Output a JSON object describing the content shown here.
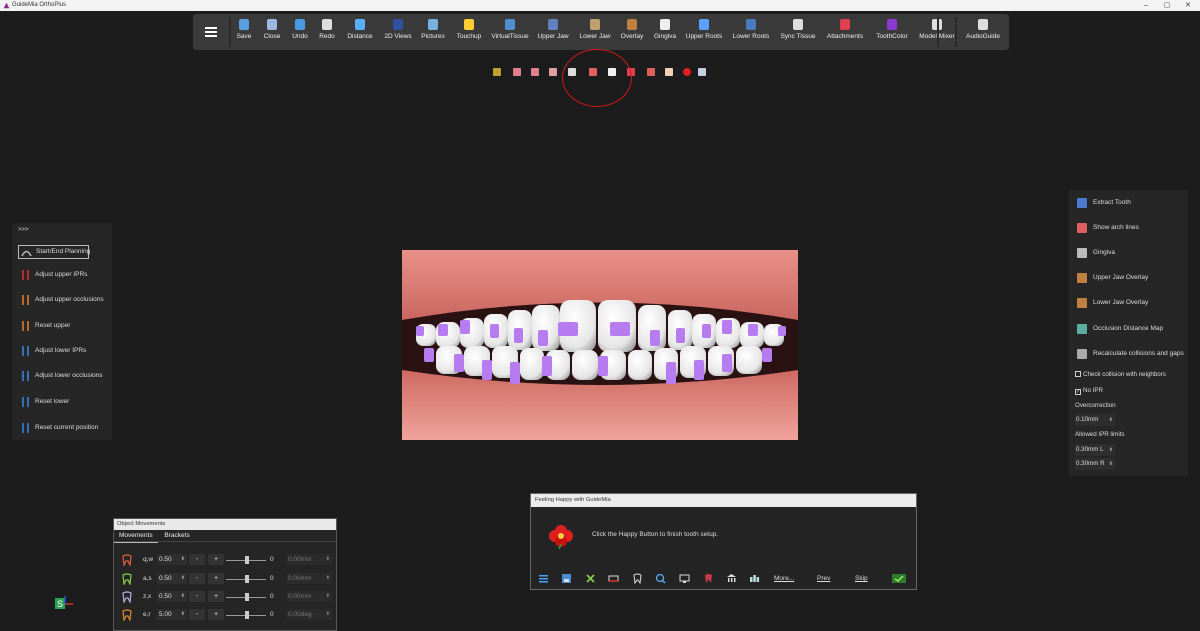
{
  "window": {
    "title": "GuideMia OrthoPlus",
    "controls": [
      "–",
      "▢",
      "✕"
    ]
  },
  "toolbar": {
    "items": [
      {
        "label": "Save",
        "icon": "save-icon"
      },
      {
        "label": "Close",
        "icon": "close-file-icon"
      },
      {
        "label": "Undo",
        "icon": "undo-icon"
      },
      {
        "label": "Redo",
        "icon": "redo-icon"
      },
      {
        "label": "Distance",
        "icon": "ruler-icon"
      },
      {
        "label": "2D Views",
        "icon": "2d-views-icon"
      },
      {
        "label": "Pictures",
        "icon": "pictures-icon"
      },
      {
        "label": "Touchup",
        "icon": "touchup-icon"
      },
      {
        "label": "VirtualTissue",
        "icon": "virtual-tissue-icon"
      },
      {
        "label": "Upper Jaw",
        "icon": "upper-jaw-icon"
      },
      {
        "label": "Lower Jaw",
        "icon": "lower-jaw-icon"
      },
      {
        "label": "Overlay",
        "icon": "overlay-icon"
      },
      {
        "label": "Gingiva",
        "icon": "gingiva-icon"
      },
      {
        "label": "Upper Roots",
        "icon": "upper-roots-icon"
      },
      {
        "label": "Lower Roots",
        "icon": "lower-roots-icon"
      },
      {
        "label": "Sync Tissue",
        "icon": "sync-tissue-icon"
      },
      {
        "label": "Attachments",
        "icon": "attachments-icon"
      },
      {
        "label": "ToothColor",
        "icon": "tooth-color-icon"
      },
      {
        "label": "Model Mixer",
        "icon": "model-mixer-icon"
      },
      {
        "label": "AudioGuide",
        "icon": "audio-guide-icon"
      }
    ]
  },
  "view_toolbar": {
    "icons": [
      "front-view-icon",
      "left-view-icon",
      "right-view-icon",
      "split-view-icon",
      "occlusal-split-icon",
      "highlighted-view-icon",
      "lower-view-icon",
      "arch-down-icon",
      "arch-up-icon",
      "hand-icon",
      "red-dot-icon",
      "fit-view-icon"
    ]
  },
  "left_panel": {
    "toggle": ">>>",
    "items": [
      {
        "label": "Start/End Planning",
        "icon": "planning-icon"
      },
      {
        "label": "Adjust upper IPRs",
        "icon": "ipr-upper-icon"
      },
      {
        "label": "Adjust upper occlusions",
        "icon": "occlusion-upper-icon"
      },
      {
        "label": "Reset upper",
        "icon": "reset-upper-icon"
      },
      {
        "label": "Adjust lower IPRs",
        "icon": "ipr-lower-icon"
      },
      {
        "label": "Adjust lower occlusions",
        "icon": "occlusion-lower-icon"
      },
      {
        "label": "Reset lower",
        "icon": "reset-lower-icon"
      },
      {
        "label": "Reset current position",
        "icon": "reset-position-icon"
      }
    ]
  },
  "right_panel": {
    "items": [
      {
        "label": "Extract Tooth",
        "icon": "extract-tooth-icon"
      },
      {
        "label": "Show arch lines",
        "icon": "arch-lines-icon"
      },
      {
        "label": "Gingiva",
        "icon": "gingiva-icon"
      },
      {
        "label": "Upper Jaw Overlay",
        "icon": "upper-overlay-icon"
      },
      {
        "label": "Lower Jaw Overlay",
        "icon": "lower-overlay-icon"
      },
      {
        "label": "Occlusion Distance Map",
        "icon": "distance-map-icon"
      },
      {
        "label": "Recalculate collisions and gaps",
        "icon": "recalculate-icon"
      }
    ],
    "check_collision": {
      "label": "Check collision with neighbors",
      "checked": false
    },
    "no_ipr": {
      "label": "No IPR",
      "checked": true
    },
    "overcorrection_label": "Overcorrection",
    "overcorrection_value": "0.10mm",
    "ipr_limits_label": "Allowed IPR limits",
    "ipr_limit_l": "0.30mm L",
    "ipr_limit_r": "0.30mm R"
  },
  "object_movements": {
    "title": "Object Movements",
    "tabs": [
      "Movements",
      "Brackets"
    ],
    "rows": [
      {
        "label": "q,w",
        "value": "0.50",
        "slider": "0",
        "amount": "0.00mm"
      },
      {
        "label": "a,s",
        "value": "0.50",
        "slider": "0",
        "amount": "0.00mm"
      },
      {
        "label": "z,x",
        "value": "0.50",
        "slider": "0",
        "amount": "0.00mm"
      },
      {
        "label": "e,r",
        "value": "5.00",
        "slider": "0",
        "amount": "0.00deg"
      }
    ],
    "minus": "-",
    "plus": "+"
  },
  "happy_dialog": {
    "title": "Feeling Happy with GuideMia",
    "message": "Click the Happy Button to finish tooth setup.",
    "more": "More...",
    "prev": "Prev",
    "skip": "Skip"
  },
  "axis_label": "S",
  "colors": {
    "bracket": "#b77cf0",
    "gum": "#e58a84",
    "highlight": "#d01818"
  }
}
